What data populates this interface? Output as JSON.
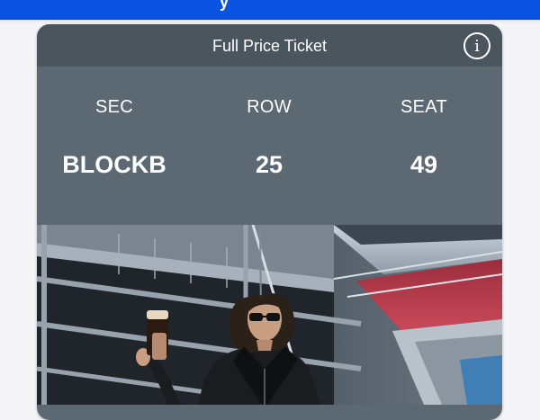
{
  "ticket": {
    "title": "Full Price Ticket",
    "info_icon": "info-circle-icon",
    "info_glyph": "i",
    "section_label": "SEC",
    "section_value": "BLOCKB",
    "row_label": "ROW",
    "row_value": "25",
    "seat_label": "SEAT",
    "seat_value": "49"
  },
  "colors": {
    "app_bar": "#0a52e0",
    "card_header": "#4b555d",
    "card_body": "#5c6872",
    "text": "#ffffff"
  }
}
